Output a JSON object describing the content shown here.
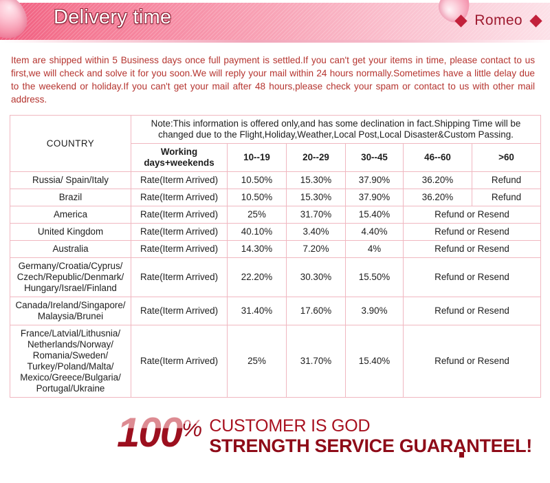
{
  "header": {
    "title": "Delivery time",
    "brand": "Romeo",
    "left_diamond": "diamond-icon",
    "right_diamond": "diamond-icon"
  },
  "intro": {
    "text": "Item are shipped within 5 Business days once full payment is settled.If you can't get your items in time, please contact to us first,we will check and solve it for you soon.We will reply your mail within 24 hours normally.Sometimes have a little delay due to the weekend or holiday.If you can't get your mail after 48 hours,please check your spam or contact to us with other mail address."
  },
  "table": {
    "country_header": "COUNTRY",
    "note": "Note:This information is offered only,and has some declination in fact.Shipping Time will be changed due to the Flight,Holiday,Weather,Local Post,Local Disaster&Custom Passing.",
    "columns": [
      "Working days+weekends",
      "10--19",
      "20--29",
      "30--45",
      "46--60",
      ">60"
    ],
    "columns_working_line1": "Working",
    "columns_working_line2": "days+weekends",
    "rate_label": "Rate(Iterm Arrived)",
    "rows": [
      {
        "country": "Russia/ Spain/Italy",
        "country_color": "red",
        "rate": "Rate(Iterm Arrived)",
        "v1": "10.50%",
        "v2": "15.30%",
        "v3": "37.90%",
        "v4": "36.20%",
        "v5": "Refund",
        "merged": false
      },
      {
        "country": "Brazil",
        "country_color": "red",
        "rate": "Rate(Iterm Arrived)",
        "v1": "10.50%",
        "v2": "15.30%",
        "v3": "37.90%",
        "v4": "36.20%",
        "v5": "Refund",
        "merged": false
      },
      {
        "country": "America",
        "country_color": "red",
        "rate": "Rate(Iterm Arrived)",
        "v1": "25%",
        "v2": "31.70%",
        "v3": "15.40%",
        "merged_value": "Refund or Resend",
        "merged": true
      },
      {
        "country": "United Kingdom",
        "country_color": "dark",
        "rate": "Rate(Iterm Arrived)",
        "v1": "40.10%",
        "v2": "3.40%",
        "v3": "4.40%",
        "merged_value": "Refund or Resend",
        "merged": true
      },
      {
        "country": "Australia",
        "country_color": "dark",
        "rate": "Rate(Iterm Arrived)",
        "v1": "14.30%",
        "v2": "7.20%",
        "v3": "4%",
        "merged_value": "Refund or Resend",
        "merged": true
      },
      {
        "country": "Germany/Croatia/Cyprus/\nCzech/Republic/Denmark/\nHungary/Israel/Finland",
        "country_color": "dark",
        "rate": "Rate(Iterm Arrived)",
        "v1": "22.20%",
        "v2": "30.30%",
        "v3": "15.50%",
        "merged_value": "Refund or Resend",
        "merged": true
      },
      {
        "country": "Canada/Ireland/Singapore/\nMalaysia/Brunei",
        "country_color": "dark",
        "rate": "Rate(Iterm Arrived)",
        "v1": "31.40%",
        "v2": "17.60%",
        "v3": "3.90%",
        "merged_value": "Refund or Resend",
        "merged": true
      },
      {
        "country": "France/Latvial/Lithusnia/\nNetherlands/Norway/\nRomania/Sweden/\nTurkey/Poland/Malta/\nMexico/Greece/Bulgaria/\nPortugal/Ukraine",
        "country_color": "dark",
        "rate": "Rate(Iterm Arrived)",
        "v1": "25%",
        "v2": "31.70%",
        "v3": "15.40%",
        "merged_value": "Refund or Resend",
        "merged": true
      }
    ]
  },
  "footer": {
    "percent_number": "100",
    "percent_symbol": "%",
    "line1": "CUSTOMER IS GOD",
    "line2": "STRENGTH SERVICE GUARANTEEL!"
  },
  "colors": {
    "accent_pink": "#ef5b7e",
    "accent_red": "#c2342f",
    "deep_red": "#9c0f1e",
    "border_pink": "#f0b7c0",
    "intro_red": "#b5342f"
  }
}
